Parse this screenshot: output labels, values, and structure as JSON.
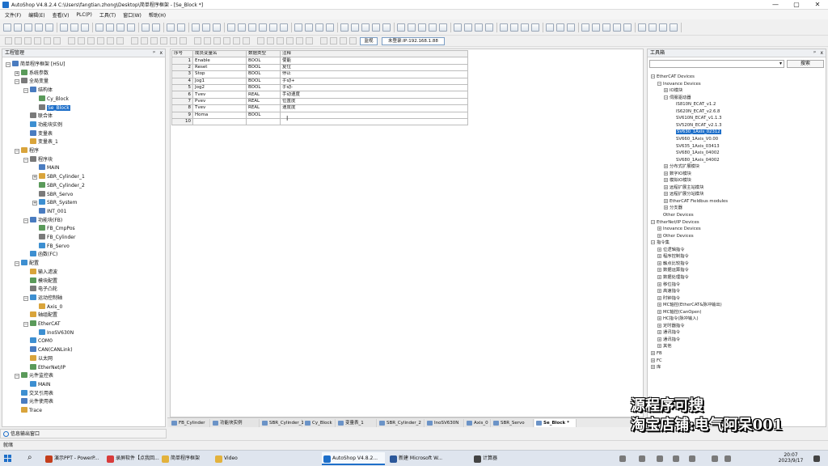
{
  "window": {
    "title": "AutoShop V4.8.2.4  C:\\Users\\fangtian.zhong\\Desktop\\简单程序框架 - [Se_Block *]",
    "buttons": {
      "minimize": "—",
      "maximize": "▢",
      "close": "✕"
    }
  },
  "menu": [
    "文件(F)",
    "编辑(E)",
    "查看(V)",
    "PLC(P)",
    "工具(T)",
    "窗口(W)",
    "帮助(H)"
  ],
  "toolbar": {
    "btn_com": "监视",
    "btn_connect": "未登录:IP:192.168.1.88"
  },
  "project_manager": {
    "title": "工程管理",
    "pin": "ᵖ",
    "close": "x",
    "items": [
      {
        "label": "简单程序框架 [H5U]",
        "level": 0,
        "exp": "−"
      },
      {
        "label": "系统参数",
        "level": 1,
        "exp": "+"
      },
      {
        "label": "全局变量",
        "level": 1,
        "exp": "−"
      },
      {
        "label": "结构体",
        "level": 2,
        "exp": "−"
      },
      {
        "label": "Cy_Block",
        "level": 3,
        "exp": ""
      },
      {
        "label": "Se_Block",
        "level": 3,
        "exp": "",
        "selected": true
      },
      {
        "label": "联合体",
        "level": 2,
        "exp": ""
      },
      {
        "label": "功能块实例",
        "level": 2,
        "exp": ""
      },
      {
        "label": "变量表",
        "level": 2,
        "exp": ""
      },
      {
        "label": "变量表_1",
        "level": 2,
        "exp": ""
      },
      {
        "label": "程序",
        "level": 1,
        "exp": "−"
      },
      {
        "label": "程序块",
        "level": 2,
        "exp": "−"
      },
      {
        "label": "MAIN",
        "level": 3,
        "exp": ""
      },
      {
        "label": "SBR_Cylinder_1",
        "level": 3,
        "exp": "+"
      },
      {
        "label": "SBR_Cylinder_2",
        "level": 3,
        "exp": ""
      },
      {
        "label": "SBR_Servo",
        "level": 3,
        "exp": ""
      },
      {
        "label": "SBR_System",
        "level": 3,
        "exp": "+"
      },
      {
        "label": "INT_001",
        "level": 3,
        "exp": ""
      },
      {
        "label": "功能块(FB)",
        "level": 2,
        "exp": "−"
      },
      {
        "label": "FB_CmpPos",
        "level": 3,
        "exp": ""
      },
      {
        "label": "FB_Cylinder",
        "level": 3,
        "exp": ""
      },
      {
        "label": "FB_Servo",
        "level": 3,
        "exp": ""
      },
      {
        "label": "函数(FC)",
        "level": 2,
        "exp": ""
      },
      {
        "label": "配置",
        "level": 1,
        "exp": "−"
      },
      {
        "label": "输入滤波",
        "level": 2,
        "exp": ""
      },
      {
        "label": "模块配置",
        "level": 2,
        "exp": ""
      },
      {
        "label": "电子凸轮",
        "level": 2,
        "exp": ""
      },
      {
        "label": "运动控制轴",
        "level": 2,
        "exp": "−"
      },
      {
        "label": "Axis_0",
        "level": 3,
        "exp": ""
      },
      {
        "label": "轴组配置",
        "level": 2,
        "exp": ""
      },
      {
        "label": "EtherCAT",
        "level": 2,
        "exp": "−"
      },
      {
        "label": "InoSV630N",
        "level": 3,
        "exp": ""
      },
      {
        "label": "COM0",
        "level": 2,
        "exp": ""
      },
      {
        "label": "CAN(CANLink)",
        "level": 2,
        "exp": ""
      },
      {
        "label": "以太网",
        "level": 2,
        "exp": ""
      },
      {
        "label": "EtherNet/IP",
        "level": 2,
        "exp": ""
      },
      {
        "label": "元件监控表",
        "level": 1,
        "exp": "−"
      },
      {
        "label": "MAIN",
        "level": 2,
        "exp": ""
      },
      {
        "label": "交叉引用表",
        "level": 1,
        "exp": ""
      },
      {
        "label": "元件使用表",
        "level": 1,
        "exp": ""
      },
      {
        "label": "Trace",
        "level": 1,
        "exp": ""
      }
    ]
  },
  "table": {
    "headers": [
      "序号",
      "成员变量名",
      "数据类型",
      "注释"
    ],
    "rows": [
      [
        "1",
        "Enable",
        "BOOL",
        "使能"
      ],
      [
        "2",
        "Reset",
        "BOOL",
        "复位"
      ],
      [
        "3",
        "Stop",
        "BOOL",
        "停止"
      ],
      [
        "4",
        "Jog1",
        "BOOL",
        "手动+"
      ],
      [
        "5",
        "Jog2",
        "BOOL",
        "手动-"
      ],
      [
        "6",
        "Tvev",
        "REAL",
        "手动速度"
      ],
      [
        "7",
        "Pvev",
        "REAL",
        "位置度"
      ],
      [
        "8",
        "Tvev",
        "REAL",
        "速度度"
      ],
      [
        "9",
        "Homa",
        "BOOL",
        ""
      ],
      [
        "10",
        "",
        "",
        ""
      ]
    ]
  },
  "tabs": [
    {
      "label": "FB_Cylinder",
      "active": false
    },
    {
      "label": "功能块实例",
      "active": false
    },
    {
      "label": "SBR_Cylinder_1",
      "active": false
    },
    {
      "label": "Cy_Block",
      "active": false
    },
    {
      "label": "变量表_1",
      "active": false
    },
    {
      "label": "SBR_Cylinder_2",
      "active": false
    },
    {
      "label": "InoSV630N",
      "active": false
    },
    {
      "label": "Axis_0",
      "active": false
    },
    {
      "label": "SBR_Servo",
      "active": false
    },
    {
      "label": "Se_Block *",
      "active": true
    }
  ],
  "toolbox": {
    "title": "工具箱",
    "pin": "ᵖ",
    "close": "x",
    "search_button": "搜索",
    "items": [
      {
        "label": "EtherCAT Devices",
        "level": 0,
        "exp": "−"
      },
      {
        "label": "Inovance Devices",
        "level": 1,
        "exp": "−"
      },
      {
        "label": "IO模块",
        "level": 2,
        "exp": "+"
      },
      {
        "label": "伺服驱动器",
        "level": 2,
        "exp": "−"
      },
      {
        "label": "IS810N_ECAT_v1.2",
        "level": 3,
        "exp": ""
      },
      {
        "label": "IS620N_ECAT_v2.6.8",
        "level": 3,
        "exp": ""
      },
      {
        "label": "SV610N_ECAT_v1.1.3",
        "level": 3,
        "exp": ""
      },
      {
        "label": "SV520N_ECAT_v2.1.3",
        "level": 3,
        "exp": ""
      },
      {
        "label": "SV630_1Axis_02312",
        "level": 3,
        "exp": "",
        "selected": true
      },
      {
        "label": "SV660_1Axis_V0.00",
        "level": 3,
        "exp": ""
      },
      {
        "label": "SV635_1Axis_03413",
        "level": 3,
        "exp": ""
      },
      {
        "label": "SV680_1Axis_04002",
        "level": 3,
        "exp": ""
      },
      {
        "label": "SV680_1Axis_04002",
        "level": 3,
        "exp": ""
      },
      {
        "label": "分布式扩展模块",
        "level": 2,
        "exp": "+"
      },
      {
        "label": "数字IO模块",
        "level": 2,
        "exp": "+"
      },
      {
        "label": "模拟IO模块",
        "level": 2,
        "exp": "+"
      },
      {
        "label": "远程扩展主站模块",
        "level": 2,
        "exp": "+"
      },
      {
        "label": "远程扩展分站模块",
        "level": 2,
        "exp": "+"
      },
      {
        "label": "EtherCAT Fieldbus modules",
        "level": 2,
        "exp": "+"
      },
      {
        "label": "分支器",
        "level": 2,
        "exp": "+"
      },
      {
        "label": "Other Devices",
        "level": 1,
        "exp": ""
      },
      {
        "label": "EtherNet/IP Devices",
        "level": 0,
        "exp": "−"
      },
      {
        "label": "Inovance Devices",
        "level": 1,
        "exp": "+"
      },
      {
        "label": "Other Devices",
        "level": 1,
        "exp": "+"
      },
      {
        "label": "指令集",
        "level": 0,
        "exp": "−"
      },
      {
        "label": "位逻辑指令",
        "level": 1,
        "exp": "+"
      },
      {
        "label": "程序控制指令",
        "level": 1,
        "exp": "+"
      },
      {
        "label": "触点比较指令",
        "level": 1,
        "exp": "+"
      },
      {
        "label": "数据运算指令",
        "level": 1,
        "exp": "+"
      },
      {
        "label": "数据处理指令",
        "level": 1,
        "exp": "+"
      },
      {
        "label": "移位指令",
        "level": 1,
        "exp": "+"
      },
      {
        "label": "高速指令",
        "level": 1,
        "exp": "+"
      },
      {
        "label": "时钟指令",
        "level": 1,
        "exp": "+"
      },
      {
        "label": "MC轴控(EtherCAT&脉冲输出)",
        "level": 1,
        "exp": "+"
      },
      {
        "label": "MC轴控(CanOpen)",
        "level": 1,
        "exp": "+"
      },
      {
        "label": "HC指令(脉冲输入)",
        "level": 1,
        "exp": "+"
      },
      {
        "label": "定时器指令",
        "level": 1,
        "exp": "+"
      },
      {
        "label": "通讯指令",
        "level": 1,
        "exp": "+"
      },
      {
        "label": "通讯指令",
        "level": 1,
        "exp": "+"
      },
      {
        "label": "其他",
        "level": 1,
        "exp": "+"
      },
      {
        "label": "FB",
        "level": 0,
        "exp": "+"
      },
      {
        "label": "FC",
        "level": 0,
        "exp": "+"
      },
      {
        "label": "库",
        "level": 0,
        "exp": "+"
      }
    ]
  },
  "info_panel": {
    "label": "信息输出窗口"
  },
  "status": {
    "left": "就绪"
  },
  "watermark": {
    "line1": "源程序可搜",
    "line2": "淘宝店铺:电气阿呆001"
  },
  "taskbar": {
    "items": [
      {
        "label": "演示PPT - PowerP...",
        "color": "#c43e1c"
      },
      {
        "label": "录屏软件【点我回...",
        "color": "#d83b3b"
      },
      {
        "label": "简单程序框架",
        "color": "#e3b23c"
      },
      {
        "label": "Video",
        "color": "#e3b23c"
      },
      {
        "label": "AutoShop V4.8.2...",
        "color": "#1e6fc9",
        "active": true
      },
      {
        "label": "新建 Microsoft W...",
        "color": "#2b579a"
      },
      {
        "label": "计算器",
        "color": "#444444"
      }
    ],
    "time": "20:07",
    "date": "2023/9/17"
  }
}
